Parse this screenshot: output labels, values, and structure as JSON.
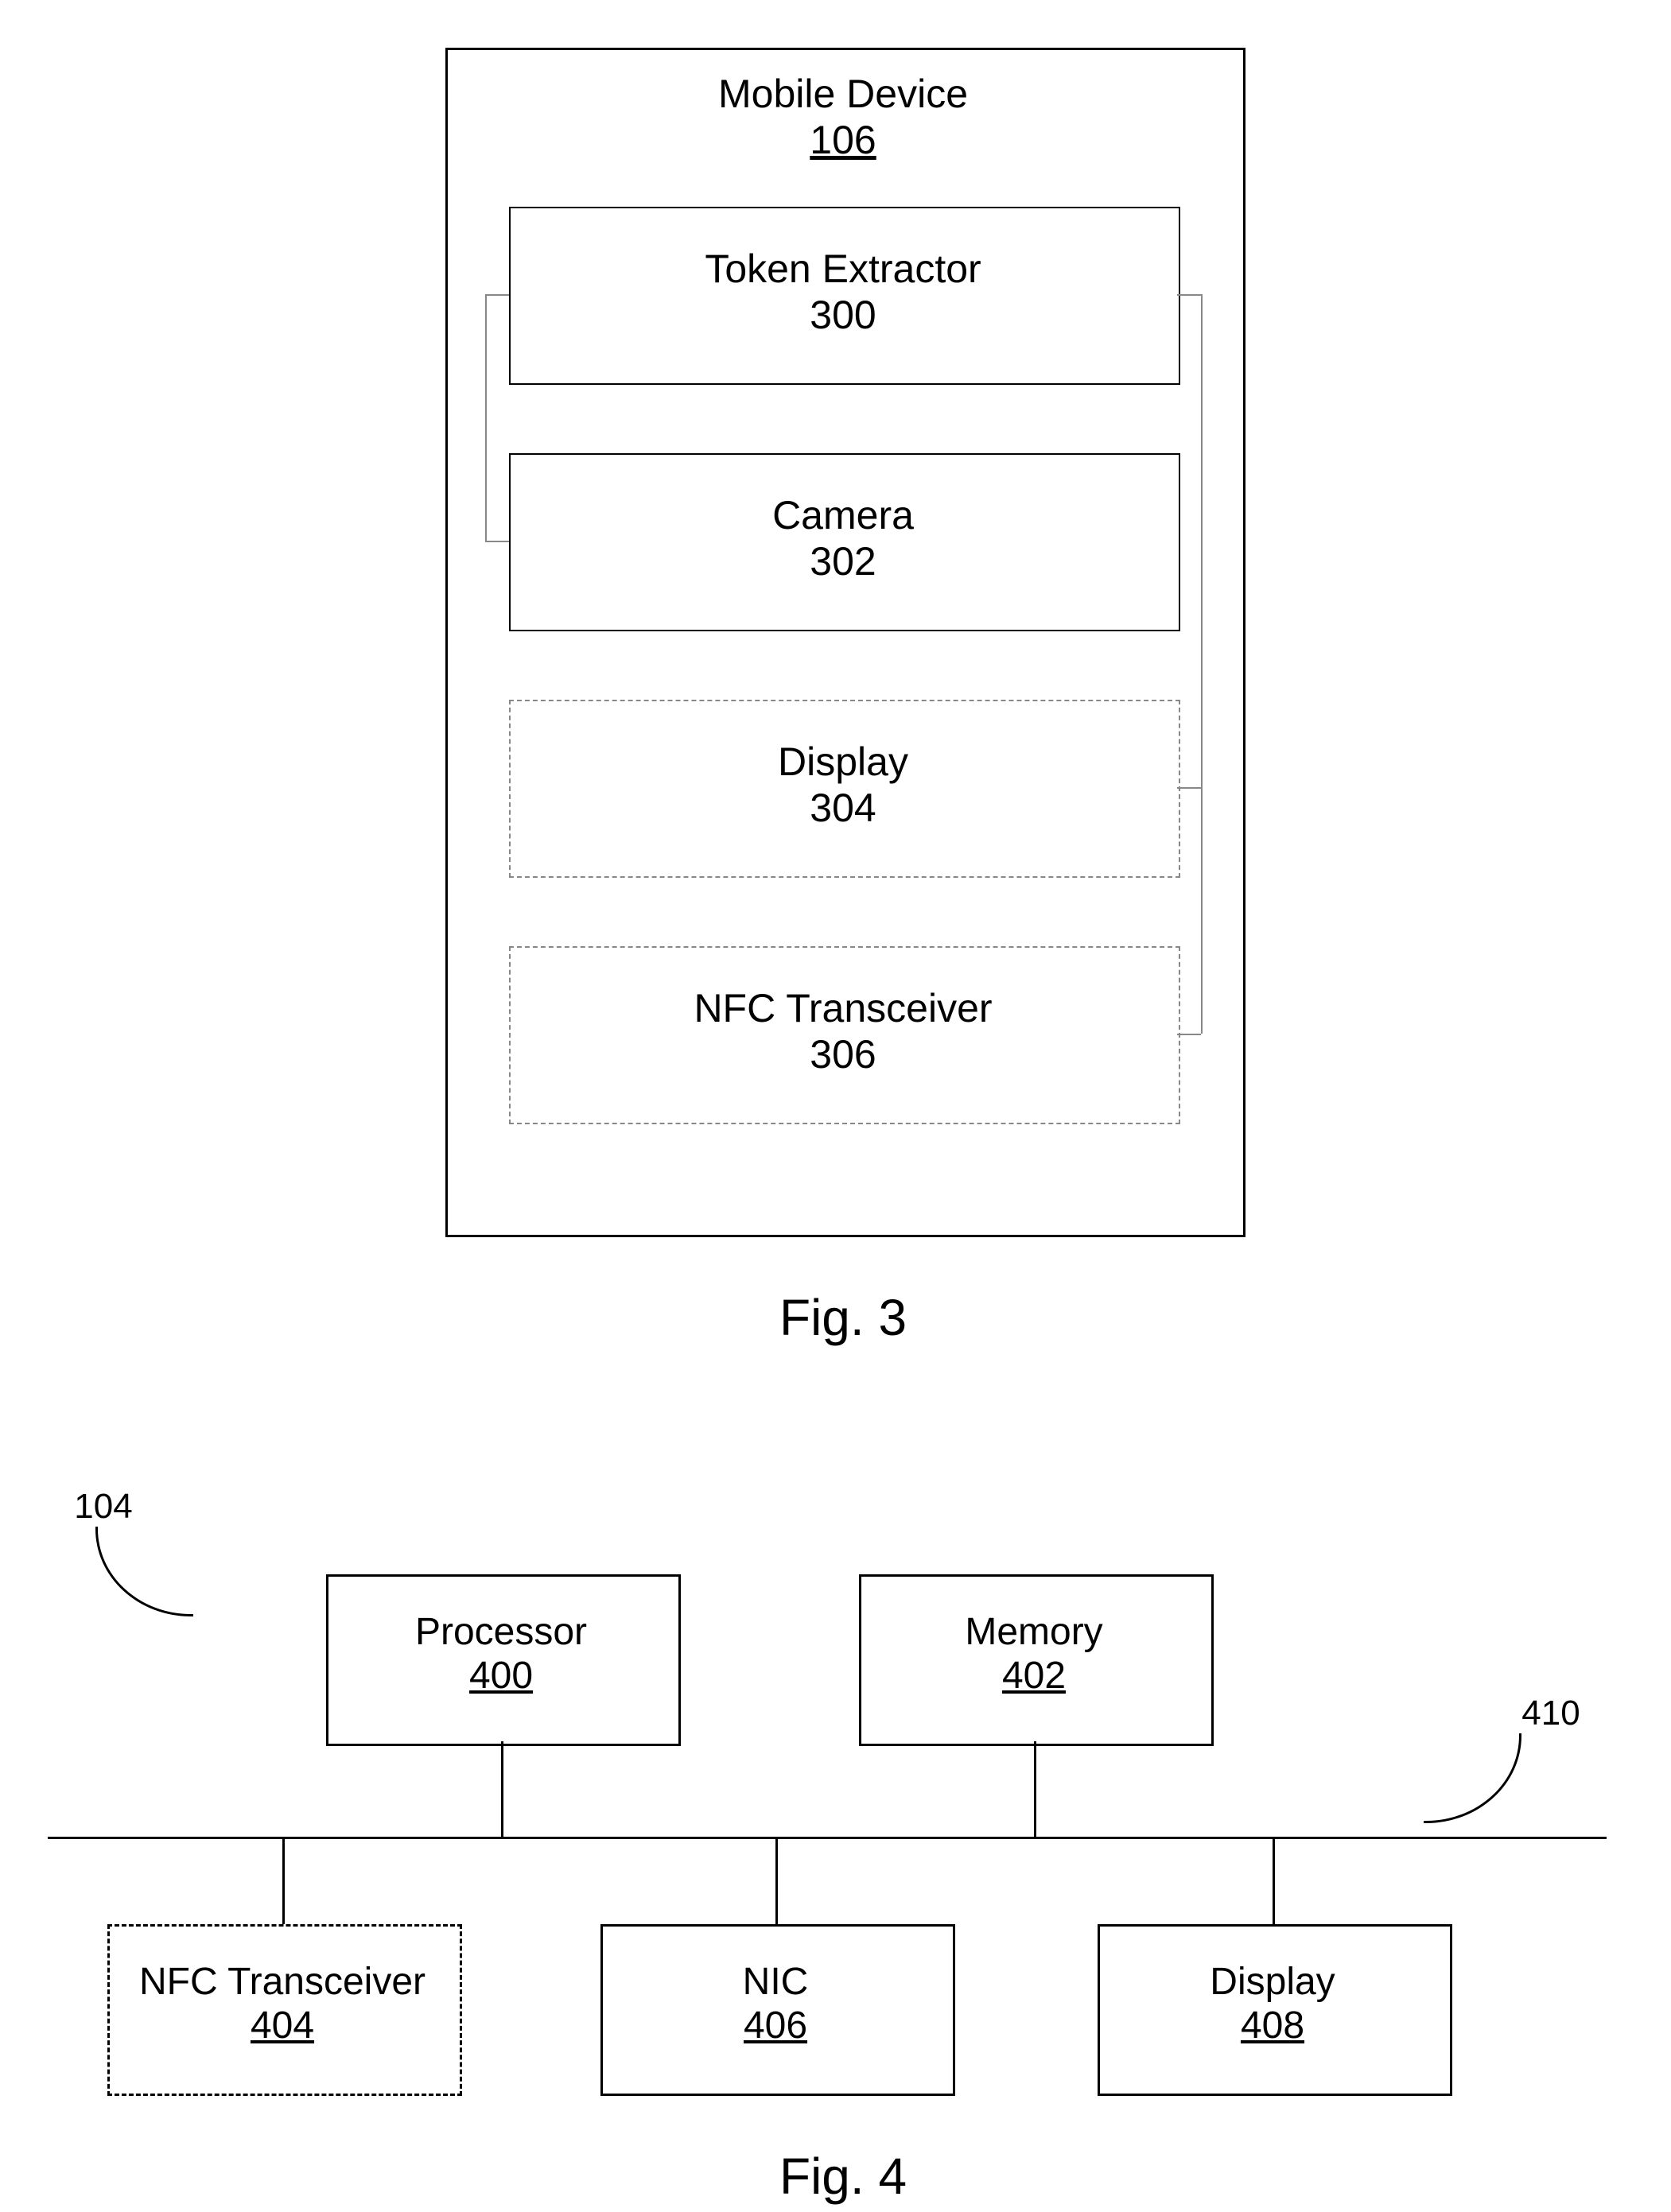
{
  "fig3": {
    "title": "Mobile Device",
    "title_ref": "106",
    "boxes": [
      {
        "name": "Token Extractor",
        "ref": "300"
      },
      {
        "name": "Camera",
        "ref": "302"
      },
      {
        "name": "Display",
        "ref": "304"
      },
      {
        "name": "NFC Transceiver",
        "ref": "306"
      }
    ],
    "caption": "Fig. 3"
  },
  "fig4": {
    "pointer_left": "104",
    "pointer_right": "410",
    "top_row": [
      {
        "name": "Processor",
        "ref": "400"
      },
      {
        "name": "Memory",
        "ref": "402"
      }
    ],
    "bottom_row": [
      {
        "name": "NFC Transceiver",
        "ref": "404"
      },
      {
        "name": "NIC",
        "ref": "406"
      },
      {
        "name": "Display",
        "ref": "408"
      }
    ],
    "caption": "Fig. 4"
  }
}
